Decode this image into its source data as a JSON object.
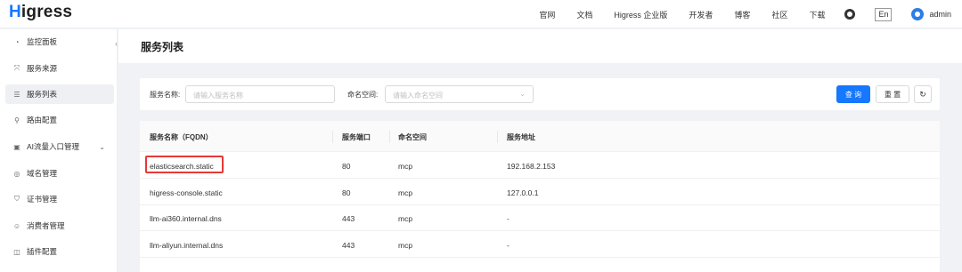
{
  "topbar": {
    "logo_h": "H",
    "logo_rest": "igress",
    "nav": [
      "官网",
      "文档",
      "Higress 企业版",
      "开发者",
      "博客",
      "社区",
      "下载"
    ],
    "lang": "En",
    "user": "admin"
  },
  "sidebar": {
    "items": [
      {
        "label": "监控面板",
        "icon": "dashboard-icon",
        "glyph": "◔"
      },
      {
        "label": "服务来源",
        "icon": "source-icon",
        "glyph": "⤧"
      },
      {
        "label": "服务列表",
        "icon": "list-icon",
        "glyph": "☰"
      },
      {
        "label": "路由配置",
        "icon": "route-icon",
        "glyph": "⚲"
      },
      {
        "label": "AI流量入口管理",
        "icon": "ai-icon",
        "glyph": "▣"
      },
      {
        "label": "域名管理",
        "icon": "globe-icon",
        "glyph": "◎"
      },
      {
        "label": "证书管理",
        "icon": "shield-icon",
        "glyph": "⛉"
      },
      {
        "label": "消费者管理",
        "icon": "user-icon",
        "glyph": "☺"
      },
      {
        "label": "插件配置",
        "icon": "plugin-icon",
        "glyph": "◫"
      }
    ],
    "active_index": 2
  },
  "page": {
    "title": "服务列表"
  },
  "filters": {
    "service_name_label": "服务名称:",
    "service_name_placeholder": "请输入服务名称",
    "namespace_label": "命名空间:",
    "namespace_placeholder": "请输入命名空间",
    "query_button": "查 询",
    "reset_button": "重 置"
  },
  "table": {
    "columns": [
      "服务名称（FQDN）",
      "服务端口",
      "命名空间",
      "服务地址"
    ],
    "rows": [
      {
        "name": "elasticsearch.static",
        "port": "80",
        "namespace": "mcp",
        "address": "192.168.2.153"
      },
      {
        "name": "higress-console.static",
        "port": "80",
        "namespace": "mcp",
        "address": "127.0.0.1"
      },
      {
        "name": "llm-ai360.internal.dns",
        "port": "443",
        "namespace": "mcp",
        "address": "-"
      },
      {
        "name": "llm-aliyun.internal.dns",
        "port": "443",
        "namespace": "mcp",
        "address": "-"
      }
    ]
  }
}
